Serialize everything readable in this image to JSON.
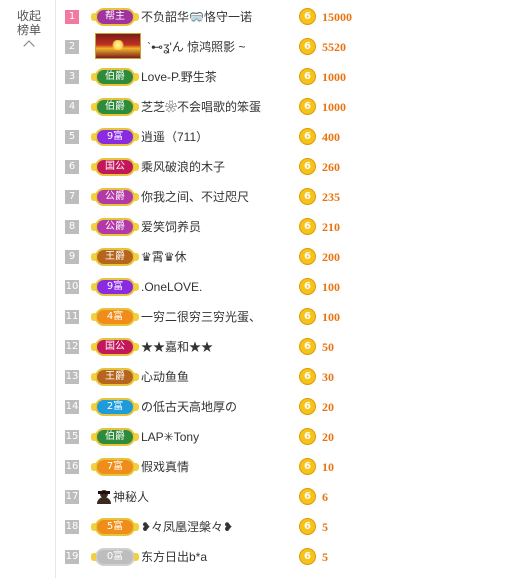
{
  "collapse": {
    "line1": "收起",
    "line2": "榜单"
  },
  "rows": [
    {
      "rank": "1",
      "badge": "帮主",
      "name": "不负韶华🥽恪守一诺",
      "amount": "15000",
      "coin": "6"
    },
    {
      "rank": "2",
      "badge": "",
      "name": "`⊷ʓ'ん 惊鸿照影 ~",
      "amount": "5520",
      "coin": "6"
    },
    {
      "rank": "3",
      "badge": "伯爵",
      "name": "Love-P.野生茶",
      "amount": "1000",
      "coin": "6"
    },
    {
      "rank": "4",
      "badge": "伯爵",
      "name": "芝芝❀不会唱歌的笨蛋",
      "amount": "1000",
      "coin": "6"
    },
    {
      "rank": "5",
      "badge": "9富",
      "name": "逍遥（711）",
      "amount": "400",
      "coin": "6"
    },
    {
      "rank": "6",
      "badge": "国公",
      "name": "乘风破浪的木子",
      "amount": "260",
      "coin": "6"
    },
    {
      "rank": "7",
      "badge": "公爵",
      "name": "你我之间、不过咫尺",
      "amount": "235",
      "coin": "6"
    },
    {
      "rank": "8",
      "badge": "公爵",
      "name": "爱笑饲养员",
      "amount": "210",
      "coin": "6"
    },
    {
      "rank": "9",
      "badge": "王爵",
      "name": "♛霄♛休",
      "amount": "200",
      "coin": "6"
    },
    {
      "rank": "10",
      "badge": "9富",
      "name": ".OneLOVE.",
      "amount": "100",
      "coin": "6"
    },
    {
      "rank": "11",
      "badge": "4富",
      "name": "一穷二很穷三穷光蛋、",
      "amount": "100",
      "coin": "6"
    },
    {
      "rank": "12",
      "badge": "国公",
      "name": "★★嘉和★★",
      "amount": "50",
      "coin": "6"
    },
    {
      "rank": "13",
      "badge": "王爵",
      "name": "心动鱼鱼",
      "amount": "30",
      "coin": "6"
    },
    {
      "rank": "14",
      "badge": "2富",
      "name": "の低古天高地厚の",
      "amount": "20",
      "coin": "6"
    },
    {
      "rank": "15",
      "badge": "伯爵",
      "name": "LAP✳Tony",
      "amount": "20",
      "coin": "6"
    },
    {
      "rank": "16",
      "badge": "7富",
      "name": "假戏真情",
      "amount": "10",
      "coin": "6"
    },
    {
      "rank": "17",
      "badge": "",
      "name": "神秘人",
      "amount": "6",
      "coin": "6"
    },
    {
      "rank": "18",
      "badge": "5富",
      "name": "❥々凤凰涅槃々❥",
      "amount": "5",
      "coin": "6"
    },
    {
      "rank": "19",
      "badge": "0富",
      "name": "东方日出b*a",
      "amount": "5",
      "coin": "6"
    }
  ],
  "colors": {
    "amount": "#e8730f",
    "coin": "#f6c21c",
    "rank_first": "#f27aa0",
    "rank_default": "#bdbdbd",
    "badge_bangzhu": "#a0339e",
    "badge_bojue": "#2e8b3b",
    "badge_fu9": "#8a2be2",
    "badge_guogong": "#c2185b",
    "badge_gongjue": "#b23aa8",
    "badge_wangjue": "#b5651d",
    "badge_fu4": "#f08c1a",
    "badge_fu2": "#1e9bdc",
    "badge_fu7": "#f08c1a",
    "badge_fu5": "#f08c1a",
    "badge_fu0": "#bdbdbd"
  }
}
